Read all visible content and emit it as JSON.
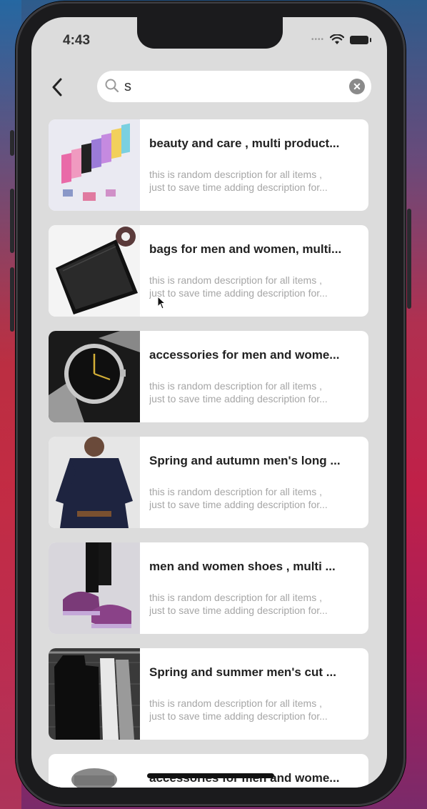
{
  "status_bar": {
    "time": "4:43"
  },
  "search": {
    "query": "s"
  },
  "results": [
    {
      "title": "beauty and care , multi product...",
      "description_line1": "this is random description for all items ,",
      "description_line2": "just to save time adding description for..."
    },
    {
      "title": "bags for men and women, multi...",
      "description_line1": "this is random description for all items ,",
      "description_line2": "just to save time adding description for..."
    },
    {
      "title": "accessories for men and wome...",
      "description_line1": "this is random description for all items ,",
      "description_line2": "just to save time adding description for..."
    },
    {
      "title": "Spring and autumn men's long ...",
      "description_line1": "this is random description for all items ,",
      "description_line2": "just to save time adding description for..."
    },
    {
      "title": "men and women shoes , multi ...",
      "description_line1": "this is random description for all items ,",
      "description_line2": "just to save time adding description for..."
    },
    {
      "title": "Spring and summer men's cut ...",
      "description_line1": "this is random description for all items ,",
      "description_line2": "just to save time adding description for..."
    },
    {
      "title": "accessories for men and wome..."
    }
  ],
  "icons": {
    "back": "chevron-left-icon",
    "search": "magnifier-icon",
    "clear": "clear-circle-icon",
    "wifi": "wifi-icon",
    "battery": "battery-icon"
  }
}
